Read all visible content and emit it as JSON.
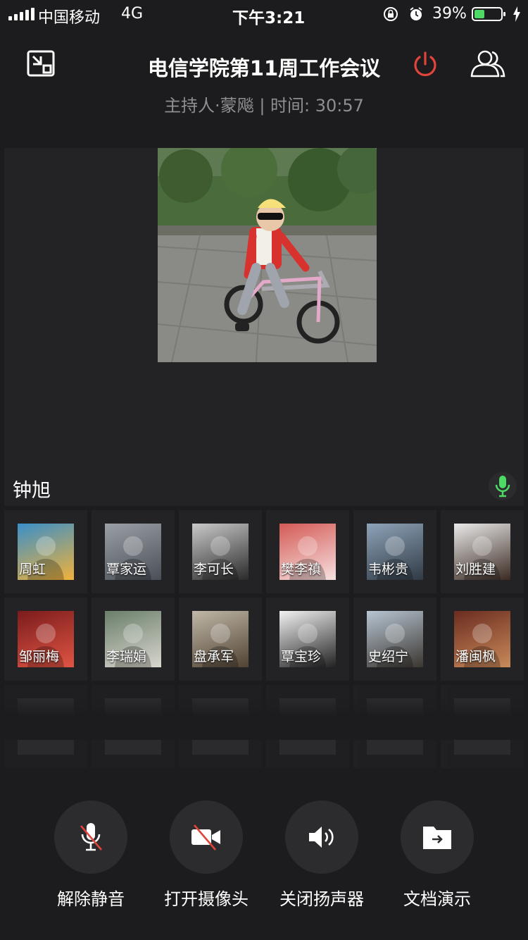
{
  "status_bar": {
    "carrier": "中国移动",
    "network": "4G",
    "time": "下午3:21",
    "battery_percent": "39%",
    "battery_level": 0.39
  },
  "header": {
    "title": "电信学院第11周工作会议",
    "subtitle": "主持人·蒙飚 | 时间: 30:57",
    "accent_color": "#e0443a"
  },
  "video": {
    "speaker_name": "钟旭",
    "mic_color": "#4cd964"
  },
  "participants": [
    {
      "name": "周虹"
    },
    {
      "name": "覃家运"
    },
    {
      "name": "李可长"
    },
    {
      "name": "樊李禛"
    },
    {
      "name": "韦彬贵"
    },
    {
      "name": "刘胜建"
    },
    {
      "name": "邹丽梅"
    },
    {
      "name": "李瑞娟"
    },
    {
      "name": "盘承军"
    },
    {
      "name": "覃宝珍"
    },
    {
      "name": "史绍宁"
    },
    {
      "name": "潘闽枫"
    }
  ],
  "controls": [
    {
      "label": "解除静音",
      "icon": "mic-muted-icon"
    },
    {
      "label": "打开摄像头",
      "icon": "camera-off-icon"
    },
    {
      "label": "关闭扬声器",
      "icon": "speaker-icon"
    },
    {
      "label": "文档演示",
      "icon": "share-document-icon"
    }
  ]
}
